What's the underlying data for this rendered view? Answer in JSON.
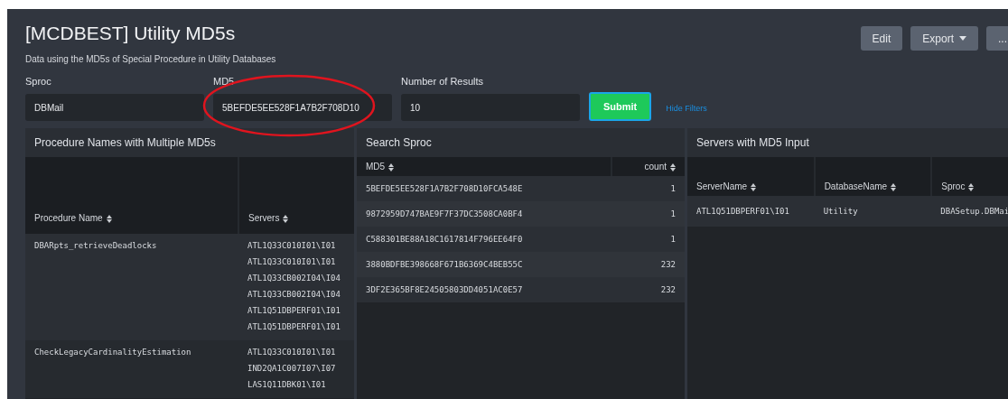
{
  "dashboard": {
    "title": "[MCDBEST] Utility MD5s",
    "description": "Data using the MD5s of Special Procedure in Utility Databases",
    "actions": [
      {
        "label": "Edit",
        "kind": "button"
      },
      {
        "label": "Export",
        "kind": "menu"
      },
      {
        "label": "...",
        "kind": "button"
      }
    ]
  },
  "filters": [
    {
      "label": "Sproc",
      "value": "DBMail",
      "circled": false
    },
    {
      "label": "MD5",
      "value": "5BEFDE5EE528F1A7B2F708D10",
      "circled": true
    },
    {
      "label": "Number of Results",
      "value": "10",
      "circled": false
    }
  ],
  "submit": "Submit",
  "hide_filters": "Hide Filters",
  "panels": [
    {
      "title": "Procedure Names with Multiple MD5s",
      "columns": [
        {
          "label": "Procedure Name"
        },
        {
          "label": "Servers"
        }
      ],
      "rows": [
        {
          "cells": [
            [
              "DBARpts_retrieveDeadlocks"
            ],
            [
              "ATL1Q33C010I01\\I01",
              "ATL1Q33C010I01\\I01",
              "ATL1Q33CB002I04\\I04",
              "ATL1Q33CB002I04\\I04",
              "ATL1Q51DBPERF01\\I01",
              "ATL1Q51DBPERF01\\I01"
            ]
          ]
        },
        {
          "cells": [
            [
              "CheckLegacyCardinalityEstimation"
            ],
            [
              "ATL1Q33C010I01\\I01",
              "IND2QA1C007I07\\I07",
              "LAS1Q11DBK01\\I01"
            ]
          ]
        }
      ]
    },
    {
      "title": "Search Sproc",
      "columns": [
        {
          "label": "MD5"
        },
        {
          "label": "count"
        }
      ],
      "rows": [
        {
          "cells": [
            [
              "5BEFDE5EE528F1A7B2F708D10FCA548E"
            ],
            [
              "1"
            ]
          ]
        },
        {
          "cells": [
            [
              "9872959D747BAE9F7F37DC3508CA0BF4"
            ],
            [
              "1"
            ]
          ]
        },
        {
          "cells": [
            [
              "C588301BE88A18C1617814F796EE64F0"
            ],
            [
              "1"
            ]
          ]
        },
        {
          "cells": [
            [
              "3880BDFBE398668F671B6369C4BEB55C"
            ],
            [
              "232"
            ]
          ]
        },
        {
          "cells": [
            [
              "3DF2E365BF8E24505803DD4051AC0E57"
            ],
            [
              "232"
            ]
          ]
        }
      ]
    },
    {
      "title": "Servers with MD5 Input",
      "columns": [
        {
          "label": "ServerName"
        },
        {
          "label": "DatabaseName"
        },
        {
          "label": "Sproc"
        }
      ],
      "rows": [
        {
          "cells": [
            [
              "ATL1Q51DBPERF01\\I01"
            ],
            [
              "Utility"
            ],
            [
              "DBASetup.DBMai"
            ]
          ]
        }
      ]
    }
  ]
}
